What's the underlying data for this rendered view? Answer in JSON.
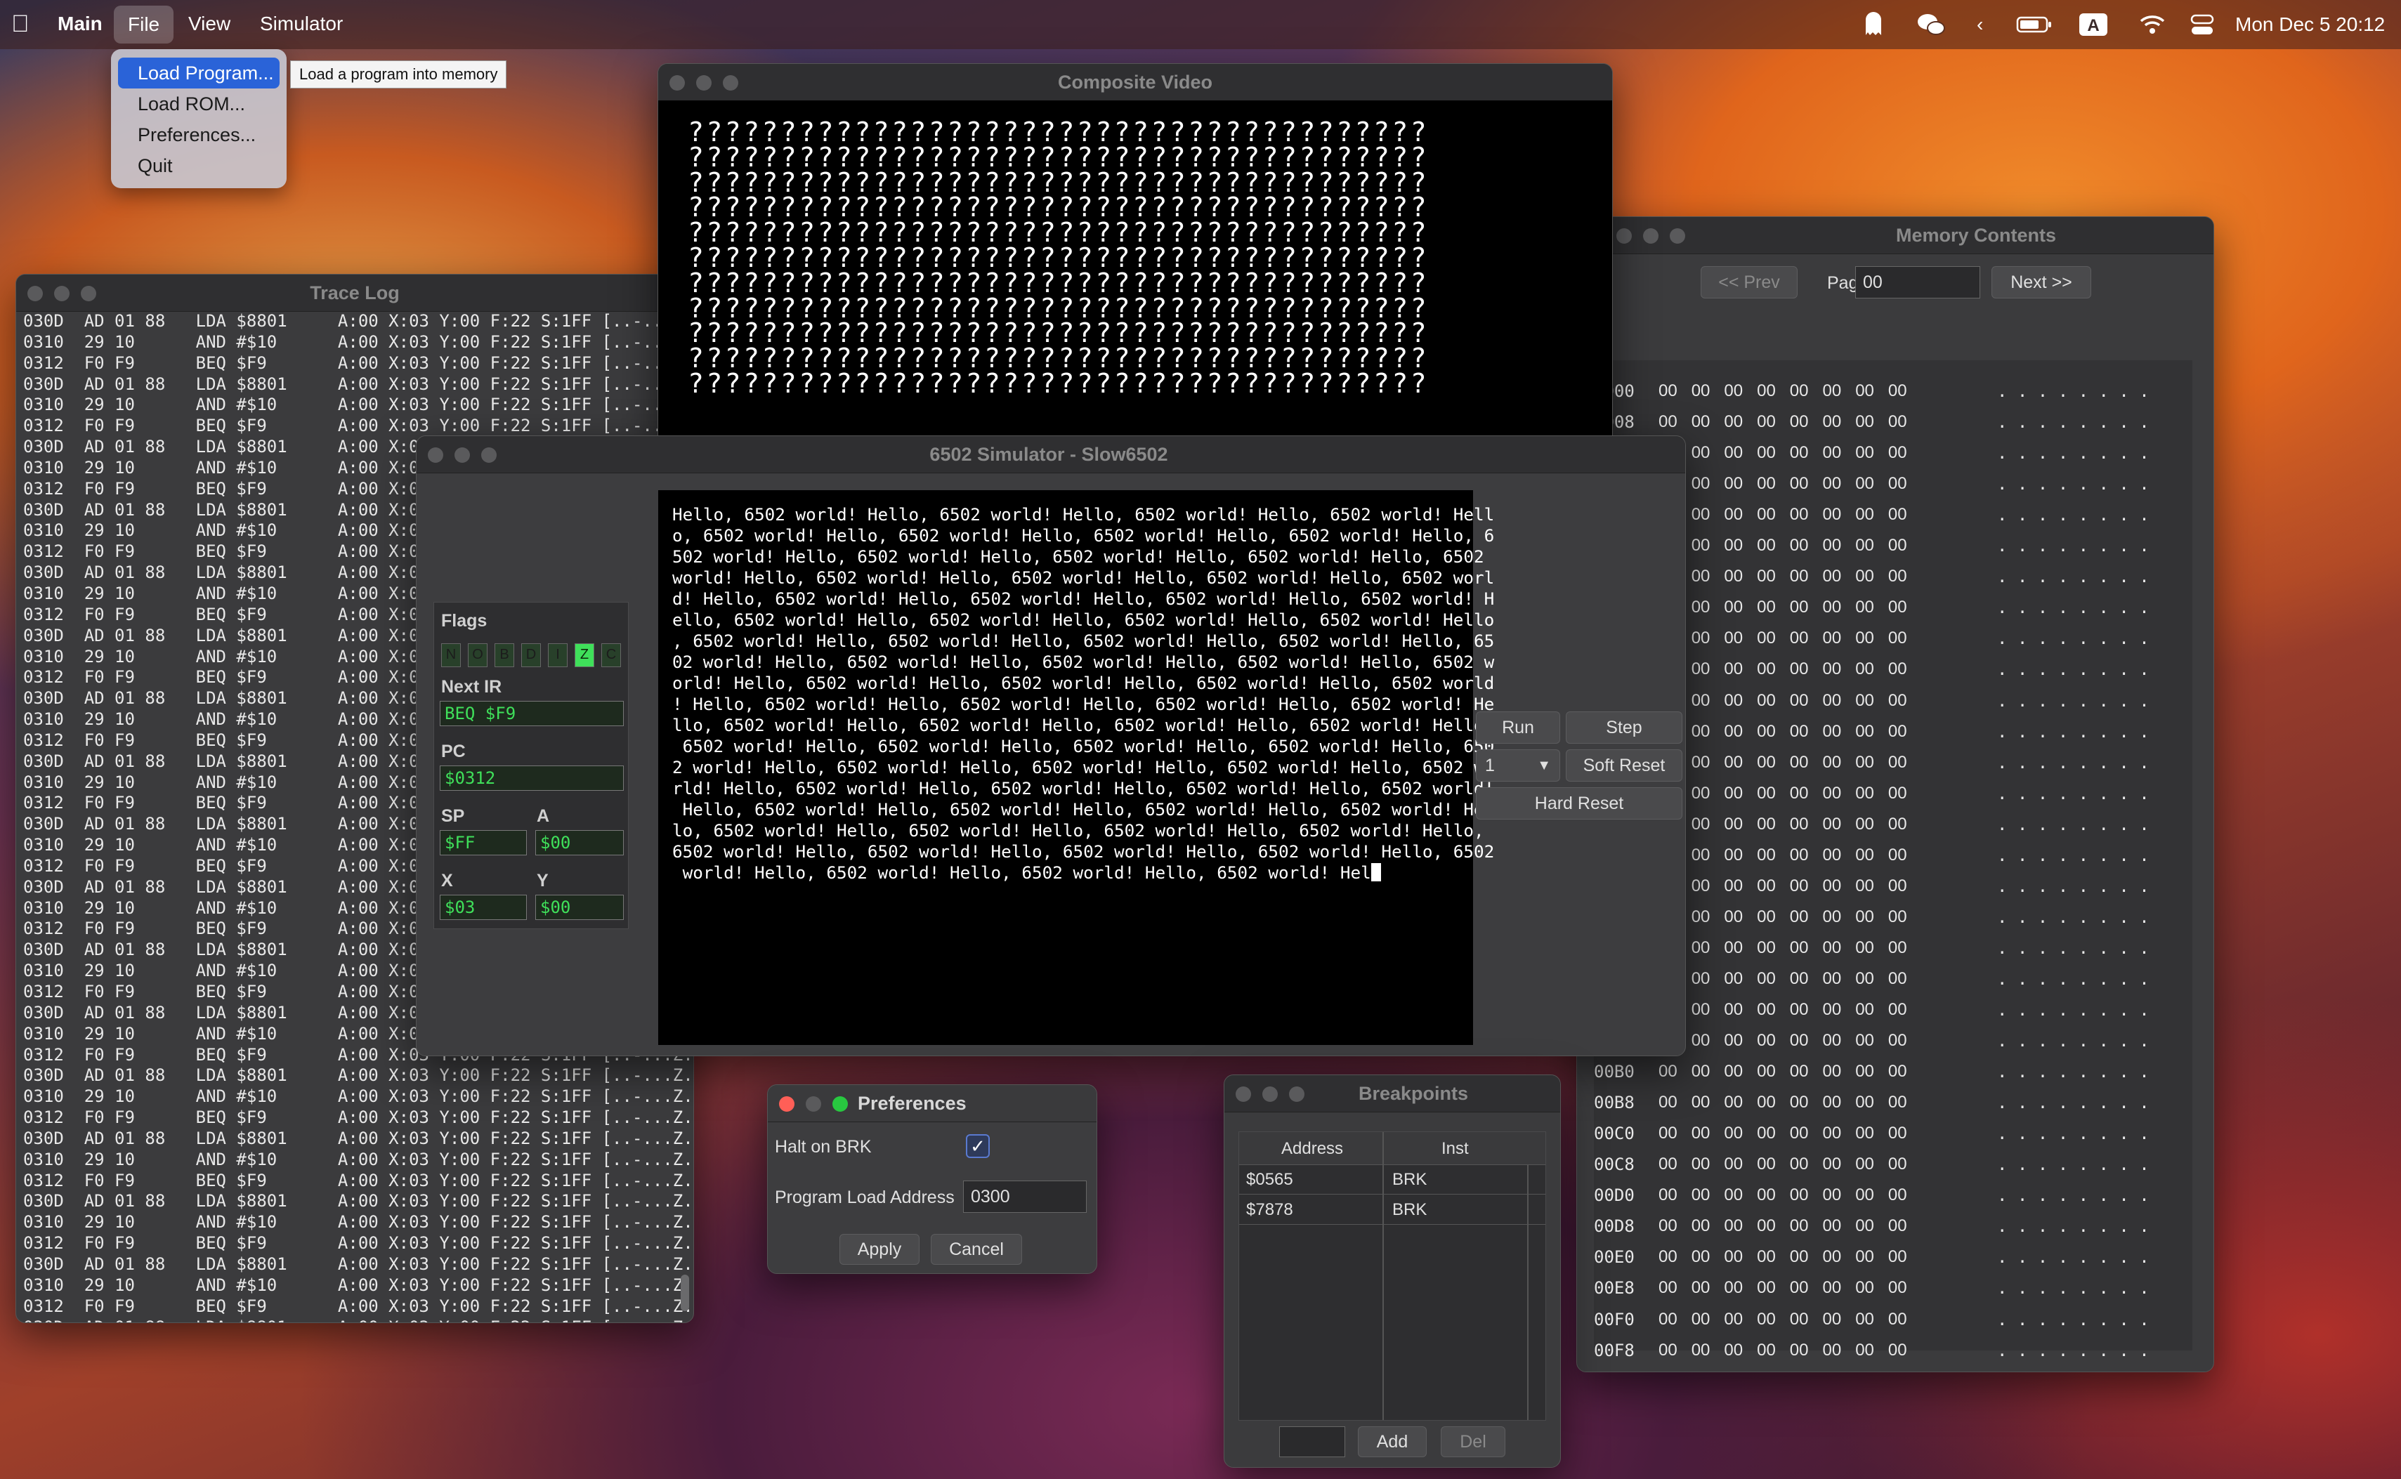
{
  "menubar": {
    "app": "Main",
    "menus": [
      "File",
      "View",
      "Simulator"
    ],
    "clock": "Mon Dec 5  20:12"
  },
  "file_menu": {
    "items": [
      "Load Program...",
      "Load ROM...",
      "Preferences...",
      "Quit"
    ],
    "tooltip": "Load a program into memory"
  },
  "trace_log": {
    "title": "Trace Log",
    "lines": [
      "030D  AD 01 88   LDA $8801     A:00 X:03 Y:00 F:22 S:1FF [..-...Z.]",
      "0310  29 10      AND #$10      A:00 X:03 Y:00 F:22 S:1FF [..-...Z.]",
      "0312  F0 F9      BEQ $F9       A:00 X:03 Y:00 F:22 S:1FF [..-...Z.]",
      "030D  AD 01 88   LDA $8801     A:00 X:03 Y:00 F:22 S:1FF [..-...Z.]",
      "0310  29 10      AND #$10      A:00 X:03 Y:00 F:22 S:1FF [..-...Z.]",
      "0312  F0 F9      BEQ $F9       A:00 X:03 Y:00 F:22 S:1FF [..-...Z.]",
      "030D  AD 01 88   LDA $8801     A:00 X:03",
      "0310  29 10      AND #$10      A:00 X:03",
      "0312  F0 F9      BEQ $F9       A:00 X:03",
      "030D  AD 01 88   LDA $8801     A:00 X:03",
      "0310  29 10      AND #$10      A:00 X:03",
      "0312  F0 F9      BEQ $F9       A:00 X:03",
      "030D  AD 01 88   LDA $8801     A:00 X:03",
      "0310  29 10      AND #$10      A:00 X:03",
      "0312  F0 F9      BEQ $F9       A:00 X:03",
      "030D  AD 01 88   LDA $8801     A:00 X:03",
      "0310  29 10      AND #$10      A:00 X:03",
      "0312  F0 F9      BEQ $F9       A:00 X:03",
      "030D  AD 01 88   LDA $8801     A:00 X:03",
      "0310  29 10      AND #$10      A:00 X:03",
      "0312  F0 F9      BEQ $F9       A:00 X:03",
      "030D  AD 01 88   LDA $8801     A:00 X:03",
      "0310  29 10      AND #$10      A:00 X:03",
      "0312  F0 F9      BEQ $F9       A:00 X:03",
      "030D  AD 01 88   LDA $8801     A:00 X:03",
      "0310  29 10      AND #$10      A:00 X:03",
      "0312  F0 F9      BEQ $F9       A:00 X:03",
      "030D  AD 01 88   LDA $8801     A:00 X:03",
      "0310  29 10      AND #$10      A:00 X:03",
      "0312  F0 F9      BEQ $F9       A:00 X:03",
      "030D  AD 01 88   LDA $8801     A:00 X:03",
      "0310  29 10      AND #$10      A:00 X:03",
      "0312  F0 F9      BEQ $F9       A:00 X:03",
      "030D  AD 01 88   LDA $8801     A:00 X:03",
      "0310  29 10      AND #$10      A:00 X:03",
      "0312  F0 F9      BEQ $F9       A:00 X:03 Y:00 F:22 S:1FF [..-...Z.]",
      "030D  AD 01 88   LDA $8801     A:00 X:03 Y:00 F:22 S:1FF [..-...Z.]",
      "0310  29 10      AND #$10      A:00 X:03 Y:00 F:22 S:1FF [..-...Z.]",
      "0312  F0 F9      BEQ $F9       A:00 X:03 Y:00 F:22 S:1FF [..-...Z.]",
      "030D  AD 01 88   LDA $8801     A:00 X:03 Y:00 F:22 S:1FF [..-...Z.]",
      "0310  29 10      AND #$10      A:00 X:03 Y:00 F:22 S:1FF [..-...Z.]",
      "0312  F0 F9      BEQ $F9       A:00 X:03 Y:00 F:22 S:1FF [..-...Z.]",
      "030D  AD 01 88   LDA $8801     A:00 X:03 Y:00 F:22 S:1FF [..-...Z.]",
      "0310  29 10      AND #$10      A:00 X:03 Y:00 F:22 S:1FF [..-...Z.]",
      "0312  F0 F9      BEQ $F9       A:00 X:03 Y:00 F:22 S:1FF [..-...Z.]",
      "030D  AD 01 88   LDA $8801     A:00 X:03 Y:00 F:22 S:1FF [..-...Z.]",
      "0310  29 10      AND #$10      A:00 X:03 Y:00 F:22 S:1FF [..-...Z.]",
      "0312  F0 F9      BEQ $F9       A:00 X:03 Y:00 F:22 S:1FF [..-...Z.]",
      "030D  AD 01 88   LDA $8801     A:00 X:03 Y:00 F:22 S:1FF [..-...Z.]",
      "0310  29 10      AND #$10      A:00 X:03 Y:00 F:22 S:1FF [..-...Z.]"
    ]
  },
  "composite_video": {
    "title": "Composite Video",
    "rows": [
      "????????????????????????????????????????",
      "????????????????????????????????????????",
      "????????????????????????????????????????",
      "????????????????????????????????????????",
      "????????????????????????????????????????",
      "????????????????????????????????????????",
      "????????????????????????????????????????",
      "????????????????????????????????????????",
      "????????????????????????????????????????",
      "????????????????????????????????????????",
      "????????????????????????????????????????"
    ]
  },
  "memory": {
    "title": "Memory Contents",
    "prev_label": "<< Prev",
    "page_label": "Page",
    "page_value": "00",
    "next_label": "Next >>",
    "rows": [
      {
        "addr": "0000",
        "bytes": "00   00   00   00   00   00   00   00",
        "ascii": ". . . . . . . ."
      },
      {
        "addr": "0008",
        "bytes": "00   00   00   00   00   00   00   00",
        "ascii": ". . . . . . . ."
      },
      {
        "addr": "0010",
        "bytes": "00   00   00   00   00   00   00   00",
        "ascii": ". . . . . . . ."
      },
      {
        "addr": "0018",
        "bytes": "00   00   00   00   00   00   00   00",
        "ascii": ". . . . . . . ."
      },
      {
        "addr": "0020",
        "bytes": "00   00   00   00   00   00   00   00",
        "ascii": ". . . . . . . ."
      },
      {
        "addr": "0028",
        "bytes": "00   00   00   00   00   00   00   00",
        "ascii": ". . . . . . . ."
      },
      {
        "addr": "0030",
        "bytes": "00   00   00   00   00   00   00   00",
        "ascii": ". . . . . . . ."
      },
      {
        "addr": "0038",
        "bytes": "00   00   00   00   00   00   00   00",
        "ascii": ". . . . . . . ."
      },
      {
        "addr": "0040",
        "bytes": "00   00   00   00   00   00   00   00",
        "ascii": ". . . . . . . ."
      },
      {
        "addr": "0048",
        "bytes": "00   00   00   00   00   00   00   00",
        "ascii": ". . . . . . . ."
      },
      {
        "addr": "0050",
        "bytes": "00   00   00   00   00   00   00   00",
        "ascii": ". . . . . . . ."
      },
      {
        "addr": "0058",
        "bytes": "00   00   00   00   00   00   00   00",
        "ascii": ". . . . . . . ."
      },
      {
        "addr": "0060",
        "bytes": "00   00   00   00   00   00   00   00",
        "ascii": ". . . . . . . ."
      },
      {
        "addr": "0068",
        "bytes": "00   00   00   00   00   00   00   00",
        "ascii": ". . . . . . . ."
      },
      {
        "addr": "0070",
        "bytes": "00   00   00   00   00   00   00   00",
        "ascii": ". . . . . . . ."
      },
      {
        "addr": "0078",
        "bytes": "00   00   00   00   00   00   00   00",
        "ascii": ". . . . . . . ."
      },
      {
        "addr": "0080",
        "bytes": "00   00   00   00   00   00   00   00",
        "ascii": ". . . . . . . ."
      },
      {
        "addr": "0088",
        "bytes": "00   00   00   00   00   00   00   00",
        "ascii": ". . . . . . . ."
      },
      {
        "addr": "0090",
        "bytes": "00   00   00   00   00   00   00   00",
        "ascii": ". . . . . . . ."
      },
      {
        "addr": "0098",
        "bytes": "00   00   00   00   00   00   00   00",
        "ascii": ". . . . . . . ."
      },
      {
        "addr": "00A0",
        "bytes": "00   00   00   00   00   00   00   00",
        "ascii": ". . . . . . . ."
      },
      {
        "addr": "00A8",
        "bytes": "00   00   00   00   00   00   00   00",
        "ascii": ". . . . . . . ."
      },
      {
        "addr": "00B0",
        "bytes": "00   00   00   00   00   00   00   00",
        "ascii": ". . . . . . . ."
      },
      {
        "addr": "00B8",
        "bytes": "00   00   00   00   00   00   00   00",
        "ascii": ". . . . . . . ."
      },
      {
        "addr": "00C0",
        "bytes": "00   00   00   00   00   00   00   00",
        "ascii": ". . . . . . . ."
      },
      {
        "addr": "00C8",
        "bytes": "00   00   00   00   00   00   00   00",
        "ascii": ". . . . . . . ."
      },
      {
        "addr": "00D0",
        "bytes": "00   00   00   00   00   00   00   00",
        "ascii": ". . . . . . . ."
      },
      {
        "addr": "00D8",
        "bytes": "00   00   00   00   00   00   00   00",
        "ascii": ". . . . . . . ."
      },
      {
        "addr": "00E0",
        "bytes": "00   00   00   00   00   00   00   00",
        "ascii": ". . . . . . . ."
      },
      {
        "addr": "00E8",
        "bytes": "00   00   00   00   00   00   00   00",
        "ascii": ". . . . . . . ."
      },
      {
        "addr": "00F0",
        "bytes": "00   00   00   00   00   00   00   00",
        "ascii": ". . . . . . . ."
      },
      {
        "addr": "00F8",
        "bytes": "00   00   00   00   00   00   00   00",
        "ascii": ". . . . . . . ."
      }
    ]
  },
  "simulator": {
    "title": "6502 Simulator - Slow6502",
    "flags_label": "Flags",
    "flags": [
      {
        "name": "N",
        "on": false
      },
      {
        "name": "O",
        "on": false
      },
      {
        "name": "B",
        "on": false
      },
      {
        "name": "D",
        "on": false
      },
      {
        "name": "I",
        "on": false
      },
      {
        "name": "Z",
        "on": true
      },
      {
        "name": "C",
        "on": false
      }
    ],
    "next_ir_label": "Next IR",
    "next_ir": "BEQ $F9",
    "pc_label": "PC",
    "pc": "$0312",
    "sp_label": "SP",
    "sp": "$FF",
    "a_label": "A",
    "a": "$00",
    "x_label": "X",
    "x": "$03",
    "y_label": "Y",
    "y": "$00",
    "run_label": "Run",
    "step_label": "Step",
    "step_count": "1",
    "soft_reset_label": "Soft Reset",
    "hard_reset_label": "Hard Reset",
    "terminal_lines": [
      "Hello, 6502 world! Hello, 6502 world! Hello, 6502 world! Hello, 6502 world! Hell",
      "o, 6502 world! Hello, 6502 world! Hello, 6502 world! Hello, 6502 world! Hello, 6",
      "502 world! Hello, 6502 world! Hello, 6502 world! Hello, 6502 world! Hello, 6502",
      "world! Hello, 6502 world! Hello, 6502 world! Hello, 6502 world! Hello, 6502 worl",
      "d! Hello, 6502 world! Hello, 6502 world! Hello, 6502 world! Hello, 6502 world! H",
      "ello, 6502 world! Hello, 6502 world! Hello, 6502 world! Hello, 6502 world! Hello",
      ", 6502 world! Hello, 6502 world! Hello, 6502 world! Hello, 6502 world! Hello, 65",
      "02 world! Hello, 6502 world! Hello, 6502 world! Hello, 6502 world! Hello, 6502 w",
      "orld! Hello, 6502 world! Hello, 6502 world! Hello, 6502 world! Hello, 6502 world",
      "! Hello, 6502 world! Hello, 6502 world! Hello, 6502 world! Hello, 6502 world! He",
      "llo, 6502 world! Hello, 6502 world! Hello, 6502 world! Hello, 6502 world! Hello,",
      " 6502 world! Hello, 6502 world! Hello, 6502 world! Hello, 6502 world! Hello, 650",
      "2 world! Hello, 6502 world! Hello, 6502 world! Hello, 6502 world! Hello, 6502 wo",
      "rld! Hello, 6502 world! Hello, 6502 world! Hello, 6502 world! Hello, 6502 world!",
      " Hello, 6502 world! Hello, 6502 world! Hello, 6502 world! Hello, 6502 world! Hel",
      "lo, 6502 world! Hello, 6502 world! Hello, 6502 world! Hello, 6502 world! Hello,",
      "6502 world! Hello, 6502 world! Hello, 6502 world! Hello, 6502 world! Hello, 6502",
      " world! Hello, 6502 world! Hello, 6502 world! Hello, 6502 world! Hel"
    ]
  },
  "preferences": {
    "title": "Preferences",
    "halt_label": "Halt on BRK",
    "halt_checked": true,
    "load_addr_label": "Program Load Address",
    "load_addr": "0300",
    "apply_label": "Apply",
    "cancel_label": "Cancel"
  },
  "breakpoints": {
    "title": "Breakpoints",
    "col_address": "Address",
    "col_inst": "Inst",
    "rows": [
      {
        "address": "$0565",
        "inst": "BRK"
      },
      {
        "address": "$7878",
        "inst": "BRK"
      }
    ],
    "add_label": "Add",
    "del_label": "Del"
  }
}
